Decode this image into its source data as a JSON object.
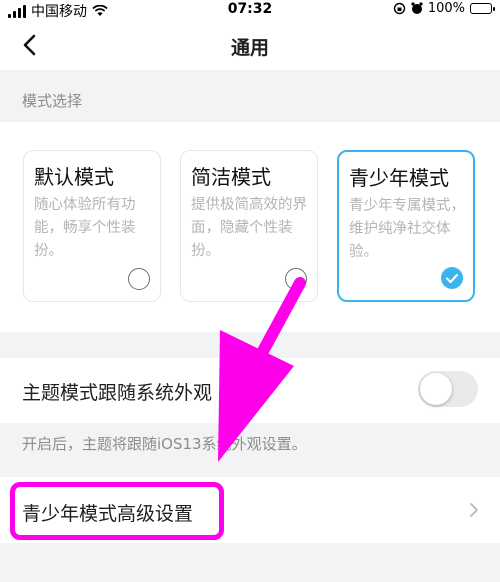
{
  "status_bar": {
    "carrier": "中国移动",
    "time": "07:32",
    "battery": "100%"
  },
  "nav": {
    "title": "通用"
  },
  "mode_section": {
    "header": "模式选择",
    "modes": [
      {
        "title": "默认模式",
        "desc": "随心体验所有功能，畅享个性装扮。",
        "selected": false
      },
      {
        "title": "简洁模式",
        "desc": "提供极简高效的界面，隐藏个性装扮。",
        "selected": false
      },
      {
        "title": "青少年模式",
        "desc": "青少年专属模式，维护纯净社交体验。",
        "selected": true
      }
    ]
  },
  "theme_follow": {
    "label": "主题模式跟随系统外观",
    "enabled": false,
    "hint": "开启后，主题将跟随iOS13系统外观设置。"
  },
  "advanced": {
    "label": "青少年模式高级设置"
  },
  "colors": {
    "accent": "#3ab4f0",
    "annotation": "#ff00ea"
  }
}
